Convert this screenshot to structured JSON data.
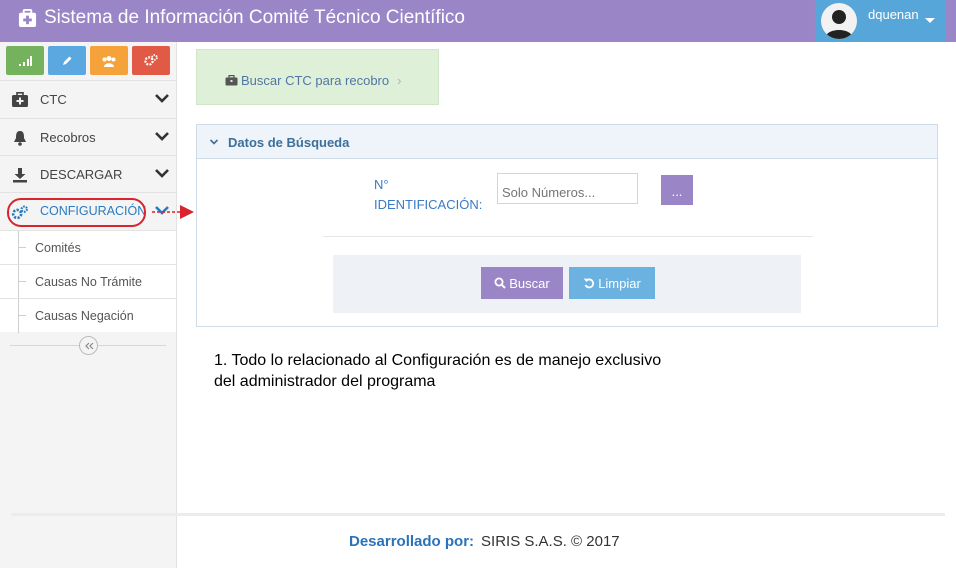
{
  "header": {
    "title": "Sistema de Información Comité Técnico Científico",
    "username": "dquenan"
  },
  "sidebar": {
    "shortcuts": [
      {
        "icon": "signal-icon",
        "color": "#74b25e"
      },
      {
        "icon": "pencil-icon",
        "color": "#5ba7df"
      },
      {
        "icon": "users-icon",
        "color": "#f6a23a"
      },
      {
        "icon": "cogs-icon",
        "color": "#e05a46"
      }
    ],
    "items": [
      {
        "label": "CTC",
        "icon": "medkit-icon"
      },
      {
        "label": "Recobros",
        "icon": "bell-icon"
      },
      {
        "label": "DESCARGAR",
        "icon": "download-icon"
      },
      {
        "label": "CONFIGURACIÓN",
        "icon": "cogs-icon",
        "active": true
      }
    ],
    "submenu": [
      "Comités",
      "Causas No Trámite",
      "Causas Negación"
    ]
  },
  "annotation": {
    "number": "1",
    "note": "1. Todo lo relacionado al Configuración es de manejo exclusivo del administrador del programa"
  },
  "breadcrumb": {
    "label": "Buscar CTC para recobro",
    "separator": "›"
  },
  "panel": {
    "title": "Datos de Búsqueda",
    "field_label_line1": "N°",
    "field_label_line2": "IDENTIFICACIÓN:",
    "input_placeholder": "Solo Números...",
    "dots_label": "...",
    "buscar_label": "Buscar",
    "limpiar_label": "Limpiar"
  },
  "footer": {
    "key": "Desarrollado por:",
    "value": "SIRIS S.A.S. © 2017"
  },
  "colors": {
    "topbar": "#9a86c6",
    "user_box": "#57a6d9",
    "accent_red": "#e2242c"
  }
}
